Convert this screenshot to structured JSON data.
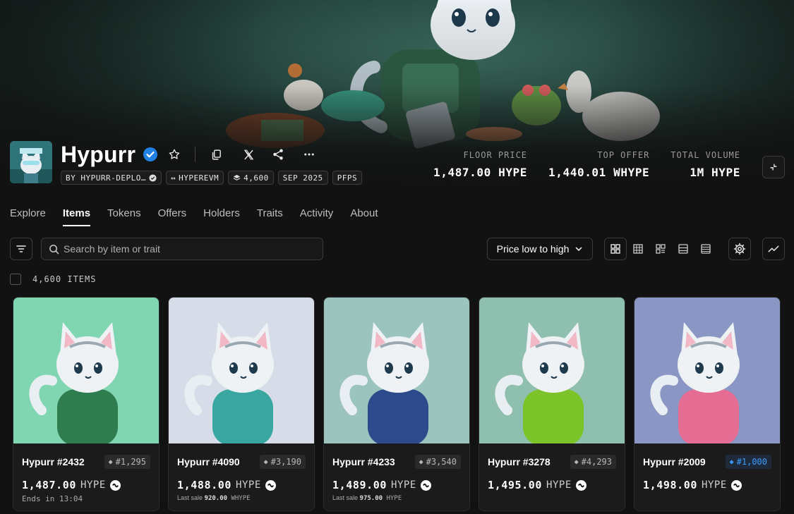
{
  "collection": {
    "name": "Hypurr",
    "tags": [
      {
        "label": "BY HYPURR-DEPLO…"
      },
      {
        "label": "HYPEREVM"
      },
      {
        "label": "4,600"
      },
      {
        "label": "SEP 2025"
      },
      {
        "label": "PFPS"
      }
    ]
  },
  "stats": [
    {
      "label": "FLOOR PRICE",
      "value": "1,487.00 HYPE"
    },
    {
      "label": "TOP OFFER",
      "value": "1,440.01 WHYPE"
    },
    {
      "label": "TOTAL VOLUME",
      "value": "1M HYPE"
    }
  ],
  "tabs": [
    "Explore",
    "Items",
    "Tokens",
    "Offers",
    "Holders",
    "Traits",
    "Activity",
    "About"
  ],
  "active_tab": "Items",
  "search": {
    "placeholder": "Search by item or trait"
  },
  "sort": {
    "label": "Price low to high"
  },
  "items_count": "4,600 ITEMS",
  "items": [
    {
      "name": "Hypurr #2432",
      "rank": "#1,295",
      "price": "1,487.00",
      "currency": "HYPE",
      "sub": "Ends in 13:04",
      "bg": "#7fd6b0",
      "accent": "#2e7d4f"
    },
    {
      "name": "Hypurr #4090",
      "rank": "#3,190",
      "price": "1,488.00",
      "currency": "HYPE",
      "sub_label": "Last sale",
      "sub_value": "920.00",
      "sub_cur": "WHYPE",
      "bg": "#d7dde8",
      "accent": "#3aa6a0"
    },
    {
      "name": "Hypurr #4233",
      "rank": "#3,540",
      "price": "1,489.00",
      "currency": "HYPE",
      "sub_label": "Last sale",
      "sub_value": "975.00",
      "sub_cur": "HYPE",
      "bg": "#9cc4be",
      "accent": "#2c4a8c"
    },
    {
      "name": "Hypurr #3278",
      "rank": "#4,293",
      "price": "1,495.00",
      "currency": "HYPE",
      "sub": "",
      "bg": "#8fbfae",
      "accent": "#7dc42a"
    },
    {
      "name": "Hypurr #2009",
      "rank": "#1,000",
      "price": "1,498.00",
      "currency": "HYPE",
      "sub": "",
      "bg": "#8a97c4",
      "accent": "#e56c93"
    }
  ]
}
